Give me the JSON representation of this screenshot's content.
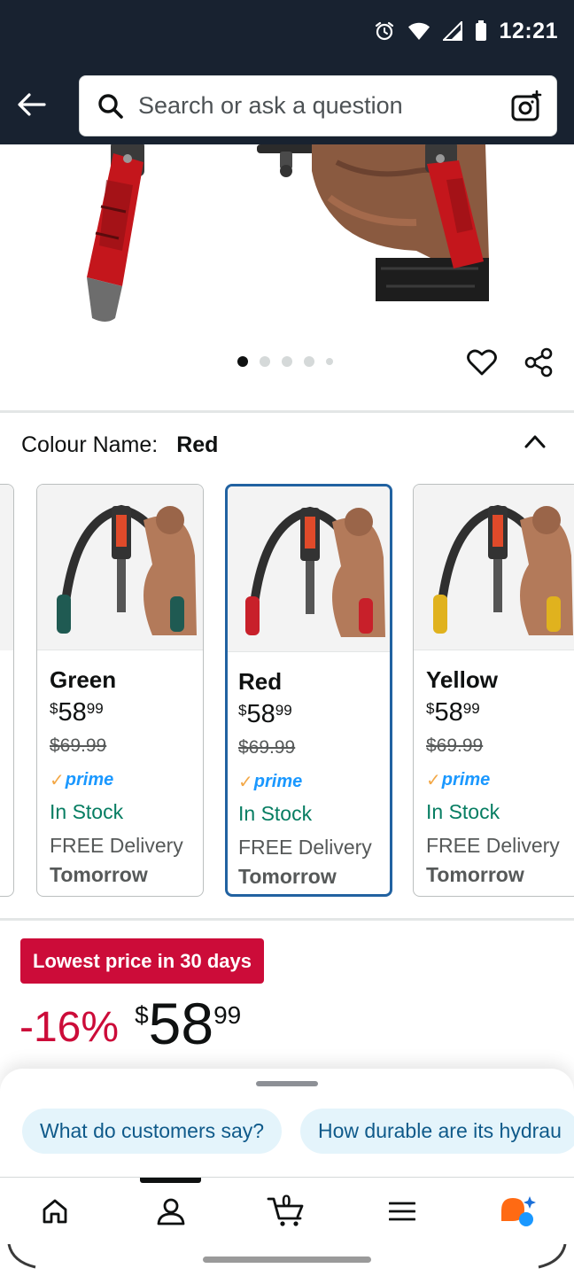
{
  "status_bar": {
    "time": "12:21"
  },
  "header": {
    "search_placeholder": "Search or ask a question"
  },
  "carousel": {
    "total_images": 5,
    "active_index": 0
  },
  "colour_selector": {
    "label": "Colour Name:",
    "selected": "Red",
    "options": [
      {
        "name": "Green",
        "price_symbol": "$",
        "price_whole": "58",
        "price_cents": "99",
        "was_price": "$69.99",
        "prime": "prime",
        "stock": "In Stock",
        "delivery": "FREE Delivery",
        "delivery_day": "Tomorrow",
        "accent_color": "#1f5a52"
      },
      {
        "name": "Red",
        "price_symbol": "$",
        "price_whole": "58",
        "price_cents": "99",
        "was_price": "$69.99",
        "prime": "prime",
        "stock": "In Stock",
        "delivery": "FREE Delivery",
        "delivery_day": "Tomorrow",
        "accent_color": "#c8202a"
      },
      {
        "name": "Yellow",
        "price_symbol": "$",
        "price_whole": "58",
        "price_cents": "99",
        "was_price": "$69.99",
        "prime": "prime",
        "stock": "In Stock",
        "delivery": "FREE Delivery",
        "delivery_day": "Tomorrow",
        "accent_color": "#e0b21e"
      }
    ]
  },
  "deal": {
    "badge": "Lowest price in 30 days",
    "discount": "-16%",
    "price_symbol": "$",
    "price_whole": "58",
    "price_cents": "99"
  },
  "suggestions": [
    "What do customers say?",
    "How durable are its hydrau"
  ],
  "bottom_nav": {
    "cart_count": "0",
    "items": [
      "home-icon",
      "account-icon",
      "cart-icon",
      "menu-icon",
      "rufus-icon"
    ]
  },
  "colors": {
    "header_bg": "#182230",
    "deal_red": "#cc0c39",
    "stock_green": "#067d62",
    "prime_blue": "#1a98ff",
    "selected_border": "#2162a1",
    "chip_bg": "#e4f4fb"
  }
}
